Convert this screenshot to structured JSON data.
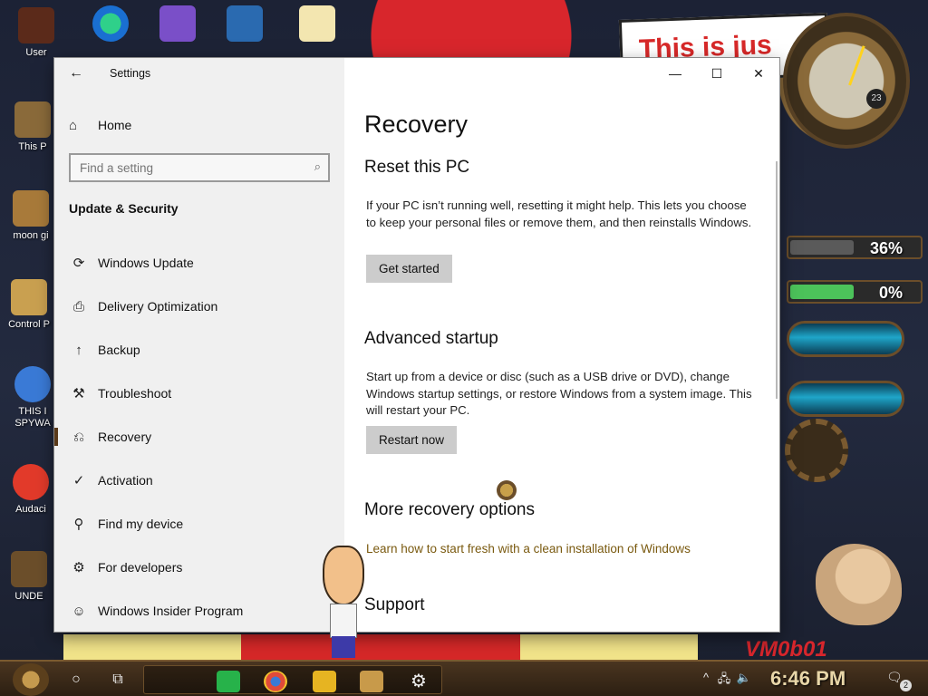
{
  "desktop": {
    "icons": [
      {
        "label": "User",
        "color": "#5b2a1a"
      },
      {
        "label": "This P",
        "color": "#8a6a3a"
      },
      {
        "label": "moon gi",
        "color": "#a87a3a"
      },
      {
        "label": "Control P",
        "color": "#c9a050"
      },
      {
        "label": "THIS I SPYWA",
        "color": "#3a7ad6"
      },
      {
        "label": "Audaci",
        "color": "#e23a2a"
      },
      {
        "label": "UNDE",
        "color": "#6b4e2a"
      }
    ],
    "banner_text": "This is jus",
    "clock_badge": "23",
    "gauges": [
      {
        "value_text": "36%",
        "fill_fraction": 0.36,
        "color": "#5a5a5a"
      },
      {
        "value_text": "0%",
        "fill_fraction": 0.6,
        "color": "#4cc25a"
      }
    ],
    "watermark": "VM0b01"
  },
  "window": {
    "title": "Settings",
    "back_glyph": "←",
    "controls": {
      "minimize": "—",
      "maximize": "☐",
      "close": "✕"
    }
  },
  "sidebar": {
    "home_label": "Home",
    "home_icon": "⌂",
    "search_placeholder": "Find a setting",
    "search_icon": "⌕",
    "section": "Update & Security",
    "items": [
      {
        "label": "Windows Update",
        "icon": "⟳"
      },
      {
        "label": "Delivery Optimization",
        "icon": "⎙"
      },
      {
        "label": "Backup",
        "icon": "↑"
      },
      {
        "label": "Troubleshoot",
        "icon": "⚒"
      },
      {
        "label": "Recovery",
        "icon": "⎌",
        "active": true
      },
      {
        "label": "Activation",
        "icon": "✓"
      },
      {
        "label": "Find my device",
        "icon": "⚲"
      },
      {
        "label": "For developers",
        "icon": "⚙"
      },
      {
        "label": "Windows Insider Program",
        "icon": "☺"
      }
    ]
  },
  "content": {
    "page_title": "Recovery",
    "reset": {
      "heading": "Reset this PC",
      "description": "If your PC isn’t running well, resetting it might help. This lets you choose to keep your personal files or remove them, and then reinstalls Windows.",
      "button": "Get started"
    },
    "advanced": {
      "heading": "Advanced startup",
      "description": "Start up from a device or disc (such as a USB drive or DVD), change Windows startup settings, or restore Windows from a system image. This will restart your PC.",
      "button": "Restart now"
    },
    "more": {
      "heading": "More recovery options",
      "link": "Learn how to start fresh with a clean installation of Windows"
    },
    "support": {
      "heading": "Support"
    }
  },
  "taskbar": {
    "search_glyph": "○",
    "taskview_glyph": "⧉",
    "pinned_apps": [
      {
        "name": "spotify",
        "color": "#27b24a"
      },
      {
        "name": "chrome",
        "color": "#e04a3a"
      },
      {
        "name": "file-explorer",
        "color": "#e6b422"
      },
      {
        "name": "game",
        "color": "#c89a4a"
      },
      {
        "name": "settings",
        "color": "#d8d8d8"
      }
    ],
    "settings_glyph": "⚙",
    "tray": {
      "chevron": "^",
      "network": "🖧",
      "volume": "🔈",
      "time": "6:46 PM",
      "notifications_count": "2",
      "notification_glyph": "🗨"
    }
  }
}
